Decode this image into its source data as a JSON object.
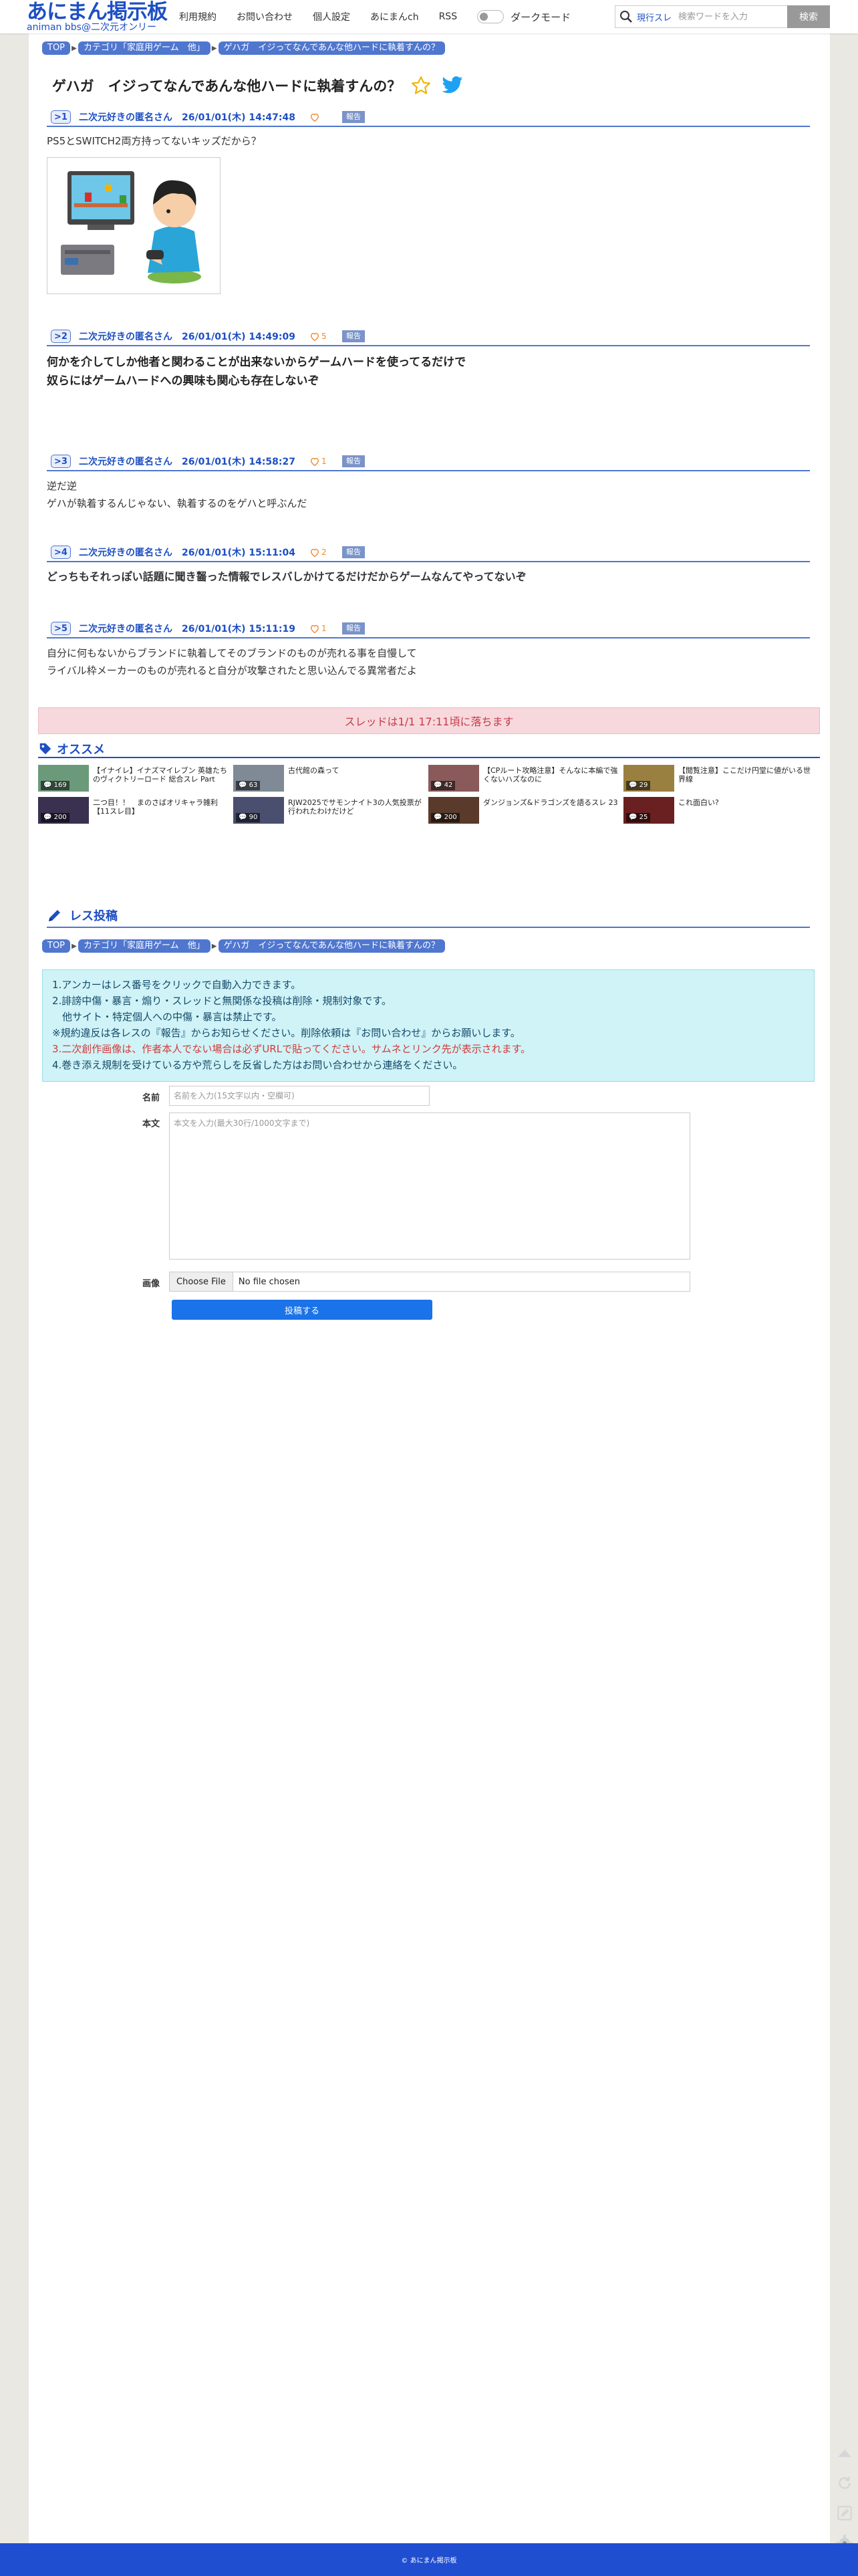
{
  "header": {
    "logo_main": "あにまん掲示板",
    "logo_sub": "animan bbs@二次元オンリー",
    "nav": [
      "利用規約",
      "お問い合わせ",
      "個人設定",
      "あにまんch",
      "RSS"
    ],
    "dark_mode_label": "ダークモード",
    "search_scope": "現行スレ",
    "search_placeholder": "検索ワードを入力",
    "search_button": "検索"
  },
  "breadcrumb": {
    "top": "TOP",
    "category": "カテゴリ「家庭用ゲーム　他」",
    "thread": "ゲハガ　イジってなんであんな他ハードに執着すんの？"
  },
  "thread_title": "ゲハガ　イジってなんであんな他ハードに執着すんの？",
  "report_label": "報告",
  "posts": [
    {
      "num": ">1",
      "name": "二次元好きの匿名さん",
      "date": "26/01/01(木) 14:47:48",
      "likes": "",
      "body": "PS5とSWITCH2両方持ってないキッズだから？"
    },
    {
      "num": ">2",
      "name": "二次元好きの匿名さん",
      "date": "26/01/01(木) 14:49:09",
      "likes": "5",
      "body": "何かを介してしか他者と関わることが出来ないからゲームハードを使ってるだけで\n奴らにはゲームハードへの興味も関心も存在しないぞ"
    },
    {
      "num": ">3",
      "name": "二次元好きの匿名さん",
      "date": "26/01/01(木) 14:58:27",
      "likes": "1",
      "body": "逆だ逆\nゲハが執着するんじゃない、執着するのをゲハと呼ぶんだ"
    },
    {
      "num": ">4",
      "name": "二次元好きの匿名さん",
      "date": "26/01/01(木) 15:11:04",
      "likes": "2",
      "body": "どっちもそれっぽい話題に聞き齧った情報でレスバしかけてるだけだからゲームなんてやってないぞ"
    },
    {
      "num": ">5",
      "name": "二次元好きの匿名さん",
      "date": "26/01/01(木) 15:11:19",
      "likes": "1",
      "body": "自分に何もないからブランドに執着してそのブランドのものが売れる事を自慢して\nライバル枠メーカーのものが売れると自分が攻撃されたと思い込んでる異常者だよ"
    }
  ],
  "fall_notice": "スレッドは1/1 17:11頃に落ちます",
  "recommend": {
    "heading": "オススメ",
    "items": [
      {
        "count": "169",
        "title": "【イナイレ】イナズマイレブン 英雄たちのヴィクトリーロード 総合スレ Part",
        "color": "#6a9a7a"
      },
      {
        "count": "63",
        "title": "古代館の森って",
        "color": "#7f8a96"
      },
      {
        "count": "42",
        "title": "【CPルート攻略注意】そんなに本編で強くないハズなのに",
        "color": "#8a5a5a"
      },
      {
        "count": "29",
        "title": "【閲覧注意】ここだけ円堂に値がいる世界線",
        "color": "#9a8040"
      },
      {
        "count": "200",
        "title": "二つ目！！　まのさばオリキャラ雑利【11スレ目】",
        "color": "#3a3050"
      },
      {
        "count": "90",
        "title": "RJW2025でサモンナイト3の人気投票が行われたわけだけど",
        "color": "#4a4f70"
      },
      {
        "count": "200",
        "title": "ダンジョンズ&ドラゴンズを語るスレ 23",
        "color": "#5a3a2a"
      },
      {
        "count": "25",
        "title": "これ面白い?",
        "color": "#6a2020"
      }
    ]
  },
  "post_form": {
    "heading": "レス投稿",
    "rules": [
      "1.アンカーはレス番号をクリックで自動入力できます。",
      "2.誹謗中傷・暴言・煽り・スレッドと無関係な投稿は削除・規制対象です。",
      "　他サイト・特定個人への中傷・暴言は禁止です。",
      "※規約違反は各レスの『報告』からお知らせください。削除依頼は『お問い合わせ』からお願いします。",
      "3.二次創作画像は、作者本人でない場合は必ずURLで貼ってください。サムネとリンク先が表示されます。",
      "4.巻き添え規制を受けている方や荒らしを反省した方はお問い合わせから連絡をください。"
    ],
    "name_label": "名前",
    "name_placeholder": "名前を入力(15文字以内・空欄可)",
    "body_label": "本文",
    "body_placeholder": "本文を入力(最大30行/1000文字まで)",
    "image_label": "画像",
    "file_button": "Choose File",
    "file_status": "No file chosen",
    "submit": "投稿する"
  },
  "footer": "© あにまん掲示板"
}
